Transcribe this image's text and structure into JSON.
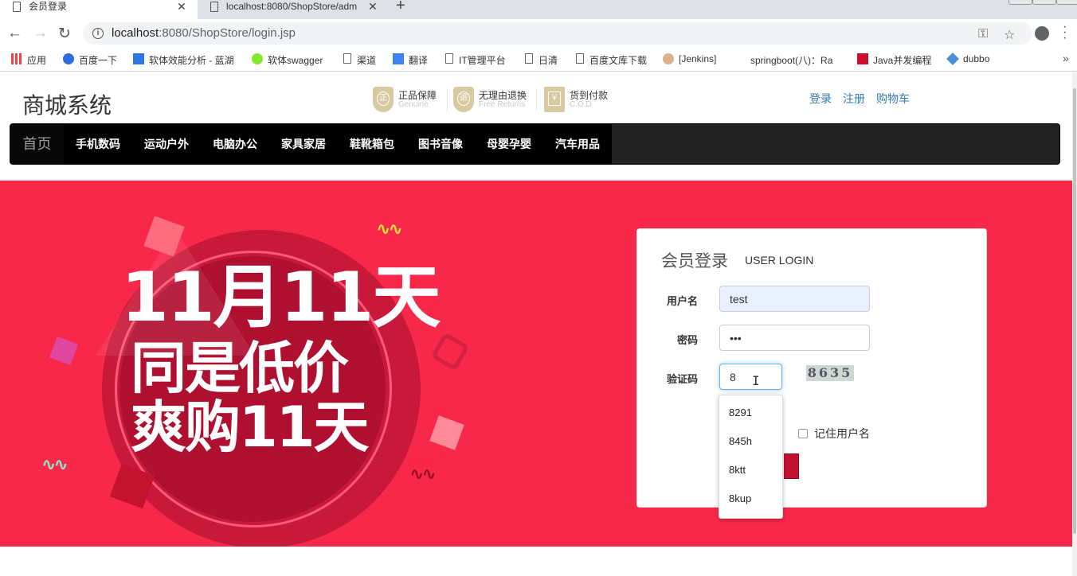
{
  "browser": {
    "tabs": [
      {
        "title": "会员登录",
        "active": true
      },
      {
        "title": "localhost:8080/ShopStore/adm",
        "active": false
      }
    ],
    "url_host": "localhost",
    "url_rest": ":8080/ShopStore/login.jsp",
    "bookmarks": [
      {
        "label": "应用",
        "icon": "apps-grid-icon"
      },
      {
        "label": "百度一下",
        "icon": "baidu-paw-icon"
      },
      {
        "label": "软体效能分析 - 蓝湖",
        "icon": "lanhu-icon"
      },
      {
        "label": "软体swagger",
        "icon": "swagger-icon"
      },
      {
        "label": "渠道",
        "icon": "page-icon"
      },
      {
        "label": "翻译",
        "icon": "translate-icon"
      },
      {
        "label": "IT管理平台",
        "icon": "page-icon"
      },
      {
        "label": "日清",
        "icon": "page-icon"
      },
      {
        "label": "百度文库下载",
        "icon": "page-icon"
      },
      {
        "label": "[Jenkins]",
        "icon": "jenkins-icon"
      },
      {
        "label": "springboot(八)：Ra",
        "icon": "blog-icon"
      },
      {
        "label": "Java并发编程",
        "icon": "csdn-icon"
      },
      {
        "label": "dubbo",
        "icon": "dubbo-icon"
      }
    ],
    "bookmarks_more": "»"
  },
  "site": {
    "logo": "商城系统",
    "promises": [
      {
        "title": "正品保障",
        "en": "Genuine",
        "glyph": "正"
      },
      {
        "title": "无理由退换",
        "en": "Free Returns",
        "glyph": "退"
      },
      {
        "title": "货到付款",
        "en": "C.O.D",
        "glyph": "￥"
      }
    ],
    "top_links": [
      "登录",
      "注册",
      "购物车"
    ],
    "nav": {
      "home": "首页",
      "categories": [
        "手机数码",
        "运动户外",
        "电脑办公",
        "家具家居",
        "鞋靴箱包",
        "图书音像",
        "母婴孕婴",
        "汽车用品"
      ]
    },
    "promo": {
      "line1": "11月11天",
      "line2": "同是低价",
      "line3": "爽购11天"
    }
  },
  "login": {
    "title": "会员登录",
    "subtitle": "USER LOGIN",
    "username_label": "用户名",
    "username_value": "test",
    "password_label": "密码",
    "password_value": "•••",
    "captcha_label": "验证码",
    "captcha_value": "8",
    "captcha_image_text": "8635",
    "remember_label": "记住用户名",
    "autocomplete": [
      "8291",
      "845h",
      "8ktt",
      "8kup"
    ]
  },
  "colors": {
    "banner": "#f8284b",
    "nav_bg": "#222222",
    "link": "#337ab7"
  }
}
